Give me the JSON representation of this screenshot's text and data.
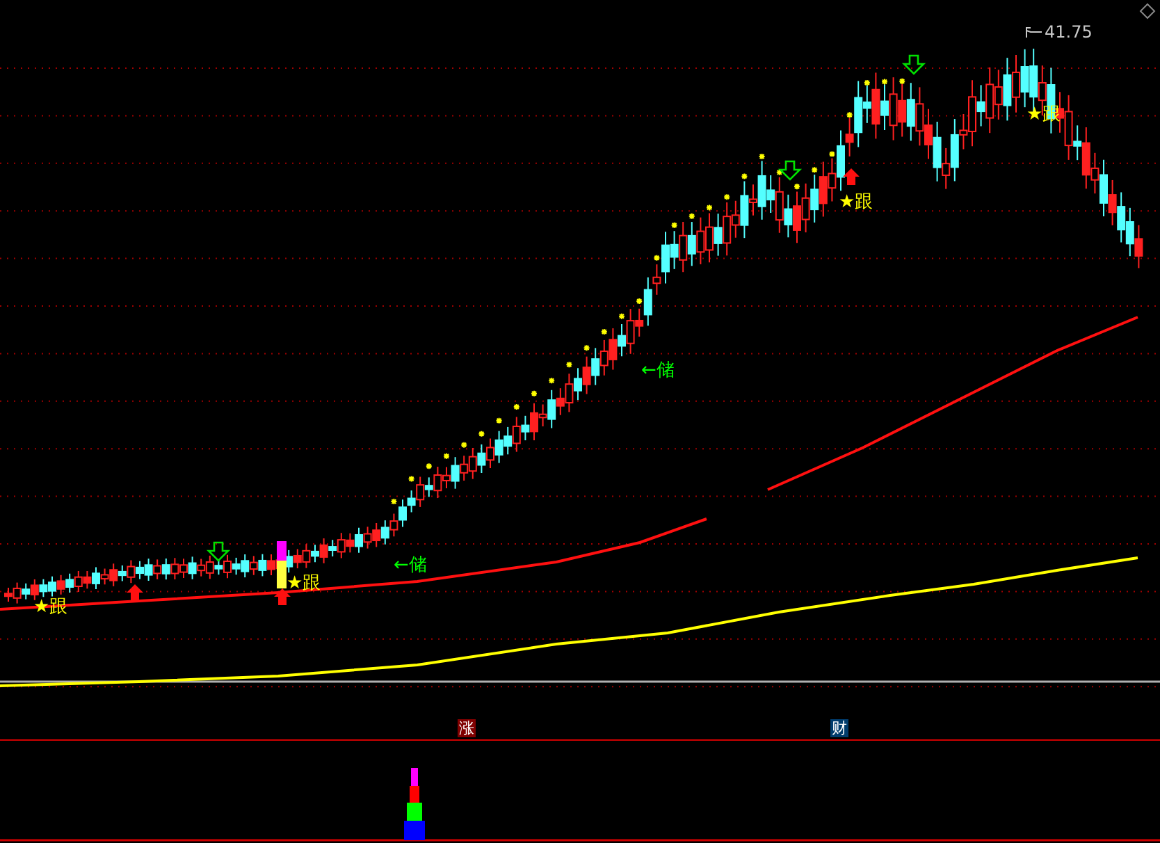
{
  "chart": {
    "price_label": "41.75",
    "follow_signals": [
      {
        "text": "★跟"
      },
      {
        "text": "★跟"
      },
      {
        "text": "★跟"
      },
      {
        "text": "★跟"
      }
    ],
    "store_signals": [
      {
        "text": "←储"
      },
      {
        "text": "←储"
      }
    ]
  },
  "indicator_panel": {
    "tags": [
      {
        "text": "涨",
        "kind": "rise"
      },
      {
        "text": "财",
        "kind": "wealth"
      }
    ]
  }
}
